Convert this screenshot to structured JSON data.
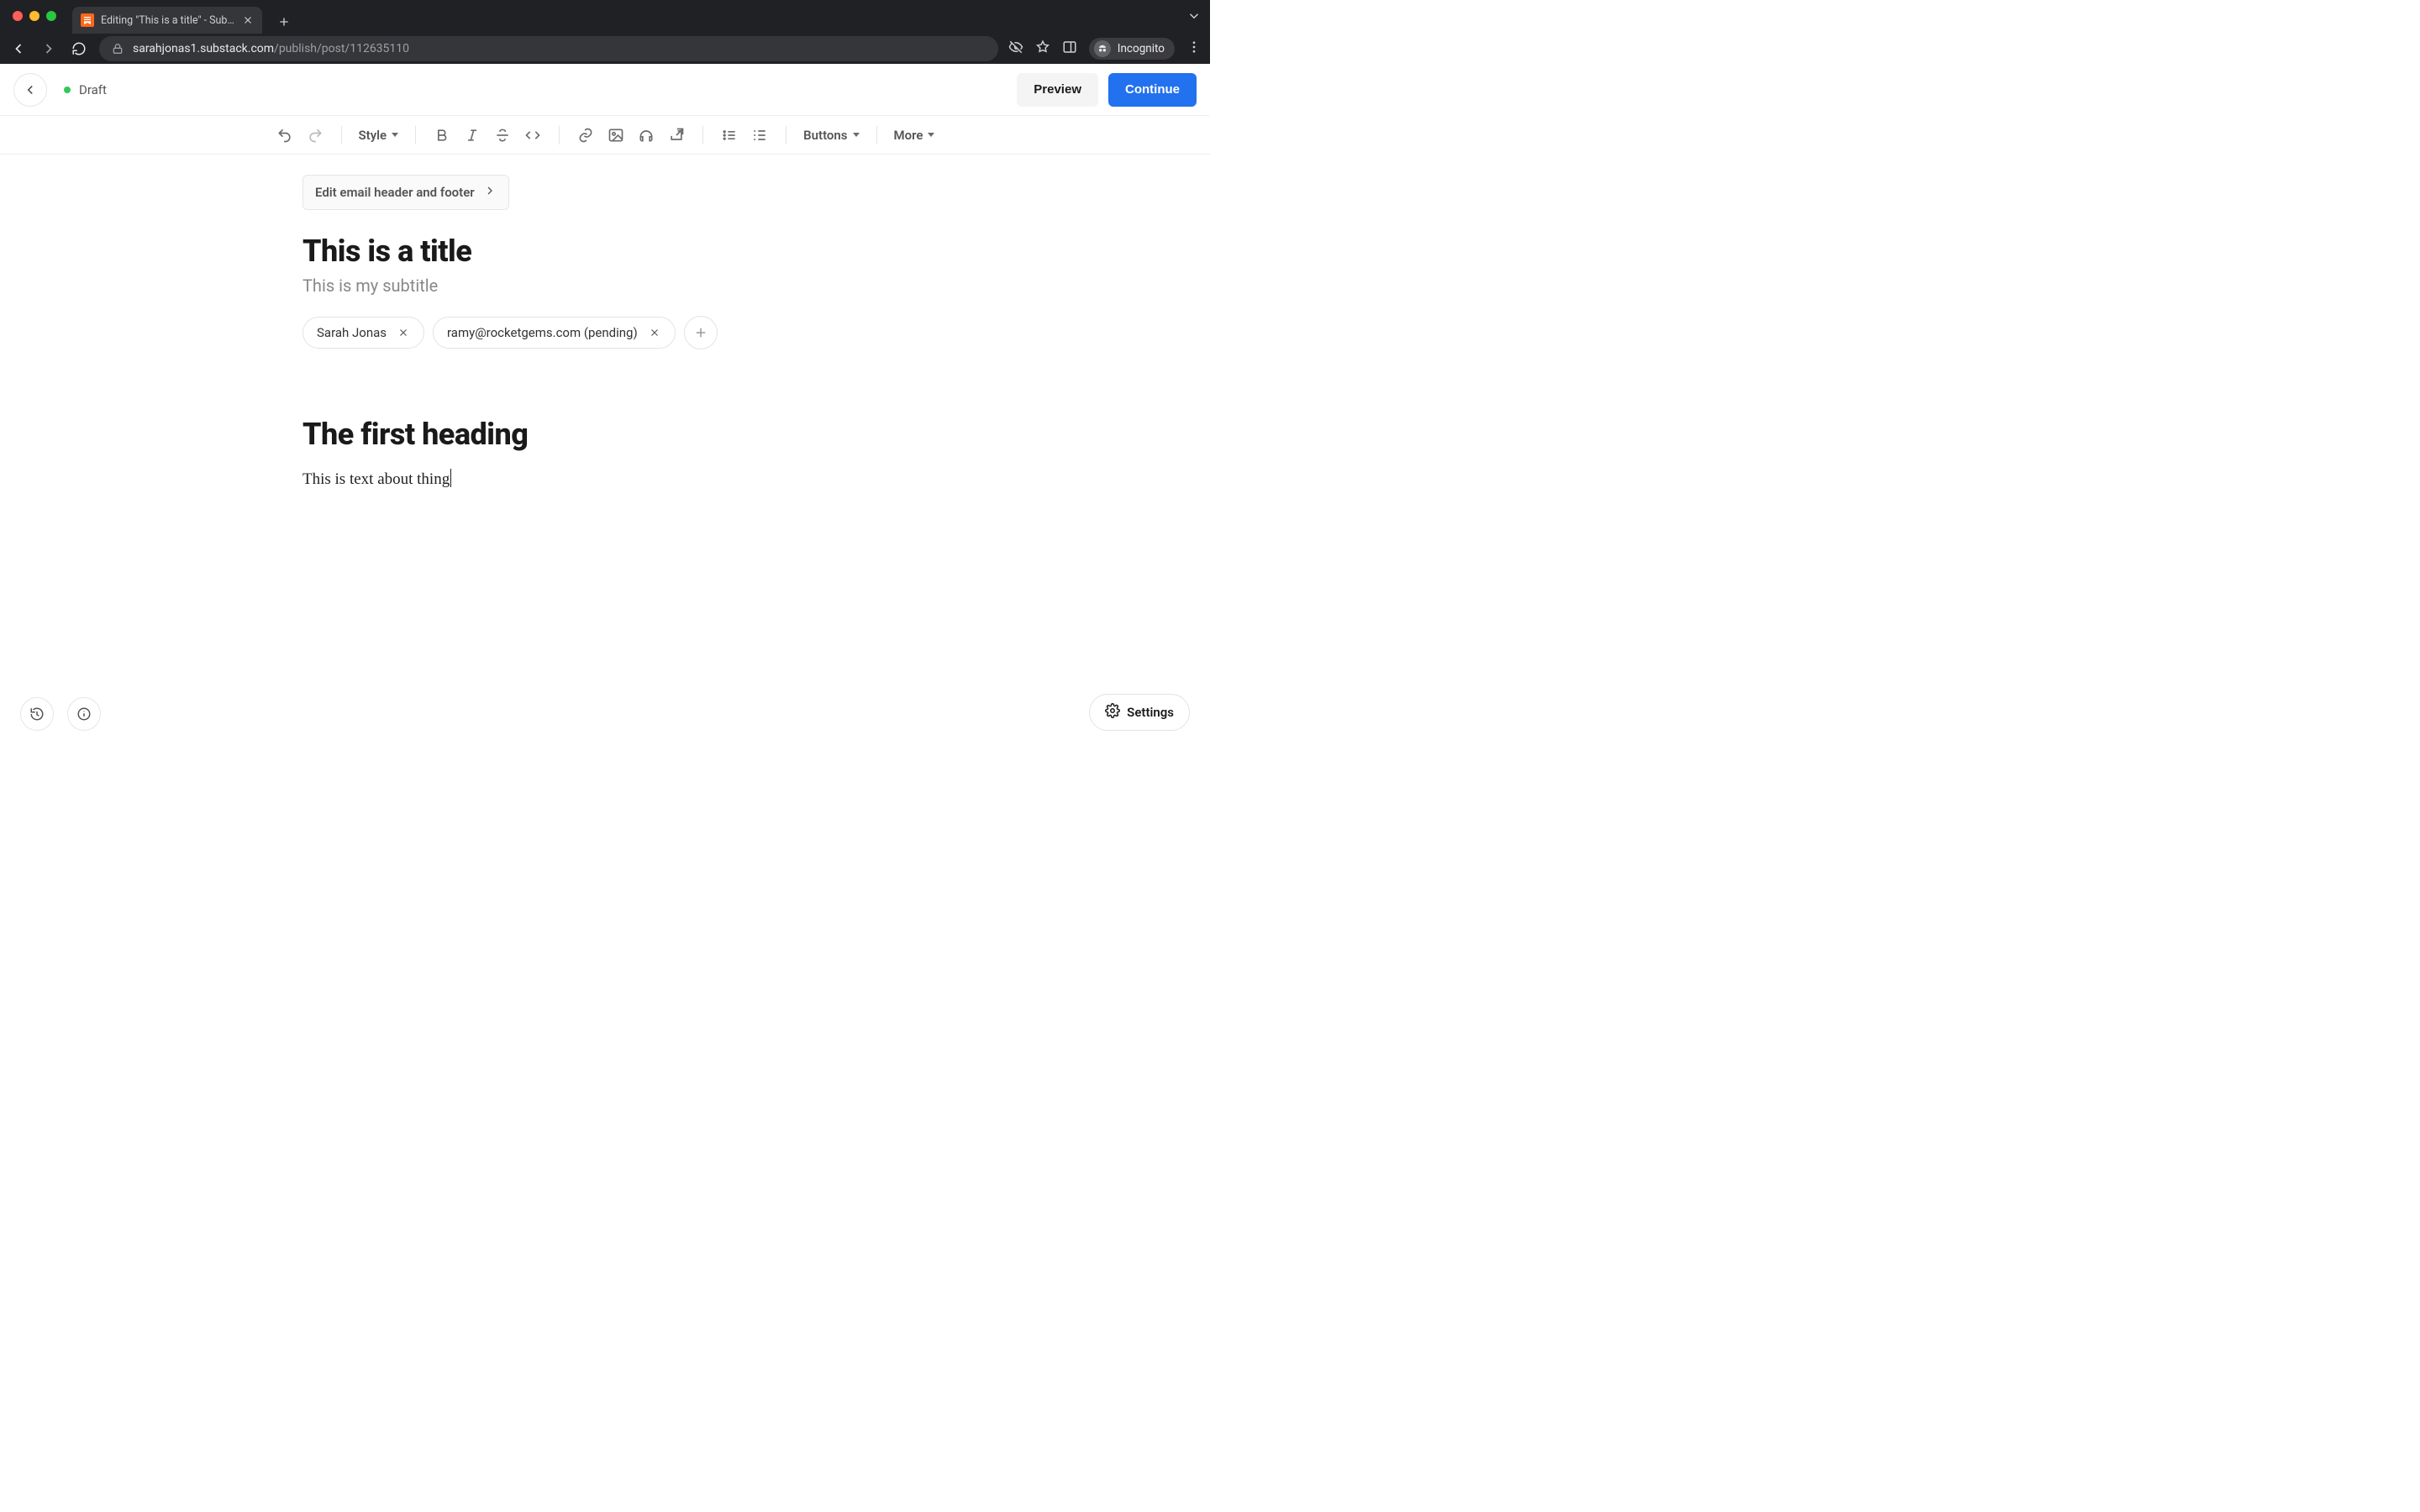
{
  "browser": {
    "tab_title": "Editing \"This is a title\" - Subst…",
    "url_host": "sarahjonas1.substack.com",
    "url_path": "/publish/post/112635110",
    "incognito_label": "Incognito"
  },
  "header": {
    "status_label": "Draft",
    "preview_label": "Preview",
    "continue_label": "Continue"
  },
  "toolbar": {
    "style_label": "Style",
    "buttons_label": "Buttons",
    "more_label": "More"
  },
  "editor": {
    "email_header_button": "Edit email header and footer",
    "title": "This is a title",
    "subtitle": "This is my subtitle",
    "authors": [
      {
        "label": "Sarah Jonas"
      },
      {
        "label": "ramy@rocketgems.com (pending)"
      }
    ],
    "body_heading": "The first heading",
    "body_text": "This is text about thing"
  },
  "footer": {
    "settings_label": "Settings"
  }
}
